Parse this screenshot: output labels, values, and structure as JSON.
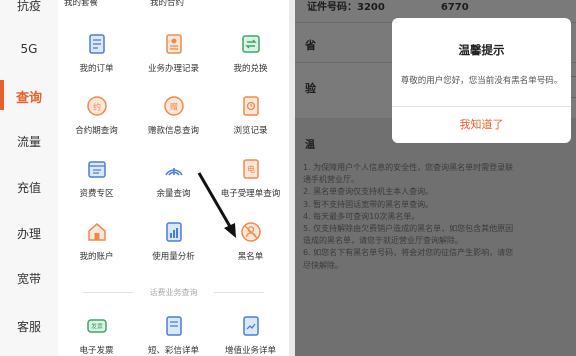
{
  "left_panel": {
    "sidebar": {
      "items": [
        {
          "label": "办理"
        },
        {
          "label": "5G"
        },
        {
          "label": "查询"
        },
        {
          "label": "流量"
        },
        {
          "label": "充值"
        },
        {
          "label": "办理"
        },
        {
          "label": "宽带"
        },
        {
          "label": "客服"
        }
      ],
      "first_item_partial": "抗疫",
      "active": "查询"
    },
    "top_partial_labels": [
      "我的套餐",
      "我的合约"
    ],
    "grid": [
      {
        "label": "我的订单",
        "icon": "order-icon"
      },
      {
        "label": "业务办理记录",
        "icon": "record-icon"
      },
      {
        "label": "我的兑换",
        "icon": "exchange-icon"
      },
      {
        "label": "合约期查询",
        "icon": "contract-icon"
      },
      {
        "label": "赠款信息查询",
        "icon": "gift-icon"
      },
      {
        "label": "浏览记录",
        "icon": "history-icon"
      },
      {
        "label": "资费专区",
        "icon": "tariff-icon"
      },
      {
        "label": "余量查询",
        "icon": "signal-icon"
      },
      {
        "label": "电子受理单查询",
        "icon": "receipt-icon"
      },
      {
        "label": "我的账户",
        "icon": "account-icon"
      },
      {
        "label": "使用量分析",
        "icon": "analysis-icon"
      },
      {
        "label": "黑名单",
        "icon": "blacklist-icon"
      }
    ],
    "section_label": "话费业务查询",
    "bottom_grid": [
      {
        "label": "电子发票",
        "icon": "invoice-icon"
      },
      {
        "label": "短、彩信详单",
        "icon": "sms-icon"
      },
      {
        "label": "增值业务详单",
        "icon": "value-added-icon"
      }
    ],
    "colors": {
      "accent": "#e8612a",
      "icon_blue": "#4a7fd8",
      "icon_orange": "#f08a4b",
      "icon_green": "#3aaa6a"
    }
  },
  "right_panel": {
    "id_label": "证件号码：",
    "id_value_start": "3200",
    "id_value_end": "6770",
    "province_label": "省",
    "verify_label": "验",
    "notes_label": "温",
    "notes": [
      "1. 为保障用户个人信息的安全性，您查询黑名单时需登录联",
      "通手机营业厅。",
      "2. 黑名单查询仅支持机主本人查询。",
      "3. 暂不支持固话宽带的黑名单查询。",
      "4. 每天最多可查询10次黑名单。",
      "5. 仅支持解除由欠费销户造成的黑名单，如您包含其他原因",
      "造成的黑名单，请您于就近营业厅查询解除。",
      "6. 如您名下有黑名单号码，将会对您的征信产生影响，请您",
      "尽快解除。"
    ],
    "modal": {
      "title": "温馨提示",
      "message": "尊敬的用户您好，您当前没有黑名单号码。",
      "button": "我知道了"
    }
  }
}
